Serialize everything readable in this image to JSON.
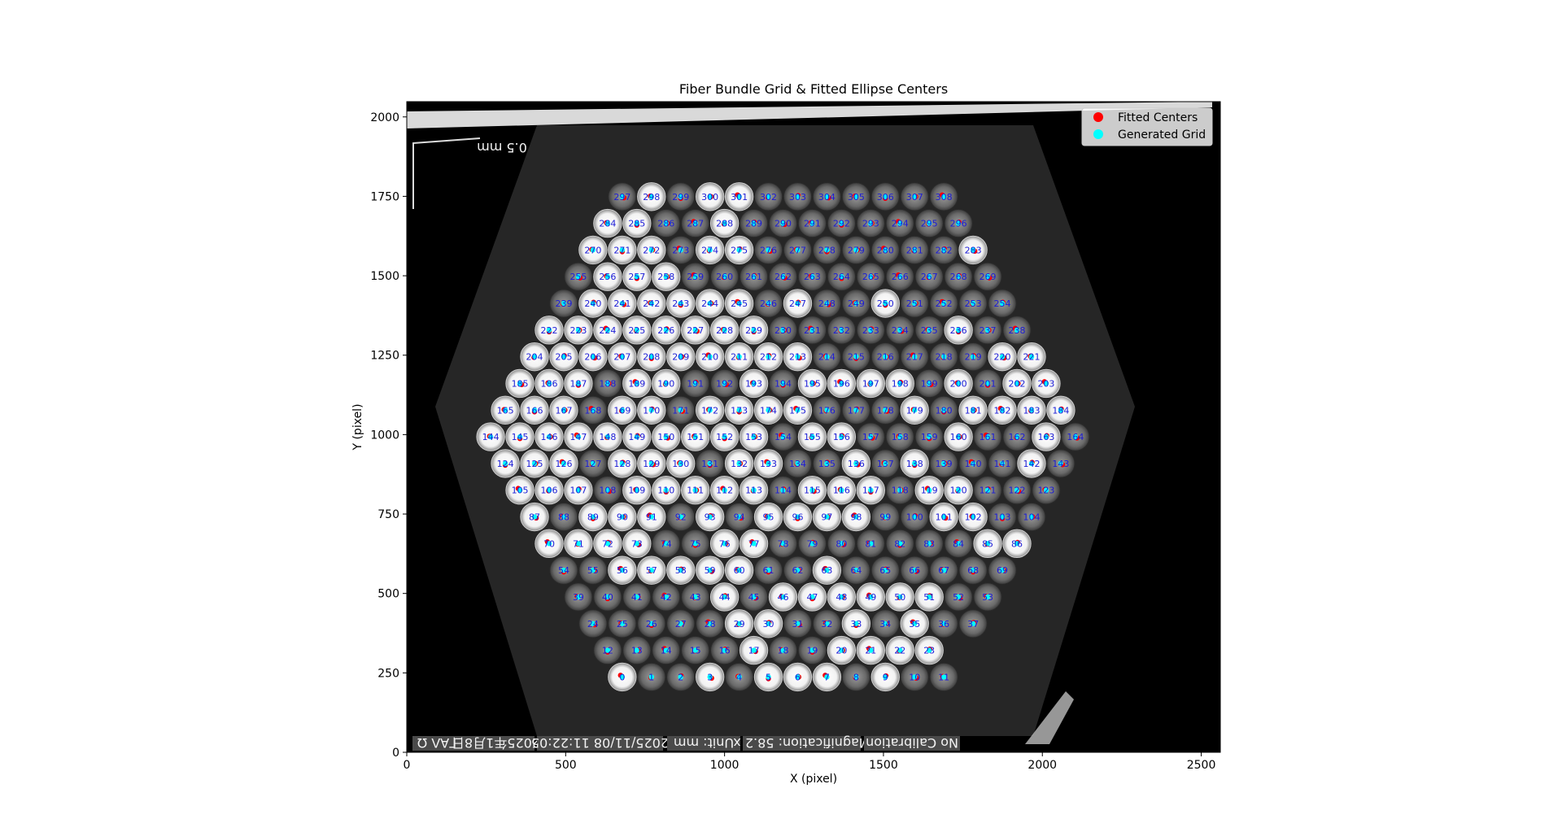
{
  "chart_data": {
    "type": "scatter",
    "title": "Fiber Bundle Grid & Fitted Ellipse Centers",
    "xlabel": "X (pixel)",
    "ylabel": "Y (pixel)",
    "xlim": [
      0,
      2560
    ],
    "ylim": [
      0,
      2048
    ],
    "xticks": [
      0,
      500,
      1000,
      1500,
      2000,
      2500
    ],
    "yticks": [
      0,
      250,
      500,
      750,
      1000,
      1250,
      1500,
      1750,
      2000
    ],
    "legend_position": "top-right",
    "series": [
      {
        "name": "Fitted Centers",
        "color": "#ff0000",
        "marker": "circle"
      },
      {
        "name": "Generated Grid",
        "color": "#00ffff",
        "marker": "circle"
      }
    ],
    "grid": {
      "rows": [
        {
          "y": 237,
          "x_start": 678,
          "count": 12,
          "first_index": 0
        },
        {
          "y": 321,
          "x_start": 632,
          "count": 12,
          "first_index": 12
        },
        {
          "y": 405,
          "x_start": 586,
          "count": 14,
          "first_index": 24
        },
        {
          "y": 489,
          "x_start": 540,
          "count": 15,
          "first_index": 39
        },
        {
          "y": 573,
          "x_start": 494,
          "count": 16,
          "first_index": 54
        },
        {
          "y": 657,
          "x_start": 448,
          "count": 17,
          "first_index": 70
        },
        {
          "y": 741,
          "x_start": 402,
          "count": 18,
          "first_index": 87
        },
        {
          "y": 825,
          "x_start": 356,
          "count": 19,
          "first_index": 105
        },
        {
          "y": 909,
          "x_start": 310,
          "count": 20,
          "first_index": 124
        },
        {
          "y": 993,
          "x_start": 264,
          "count": 21,
          "first_index": 144
        },
        {
          "y": 1077,
          "x_start": 310,
          "count": 20,
          "first_index": 165
        },
        {
          "y": 1161,
          "x_start": 356,
          "count": 19,
          "first_index": 185
        },
        {
          "y": 1245,
          "x_start": 402,
          "count": 18,
          "first_index": 204
        },
        {
          "y": 1329,
          "x_start": 448,
          "count": 17,
          "first_index": 222
        },
        {
          "y": 1413,
          "x_start": 494,
          "count": 16,
          "first_index": 239
        },
        {
          "y": 1497,
          "x_start": 540,
          "count": 15,
          "first_index": 255
        },
        {
          "y": 1581,
          "x_start": 586,
          "count": 14,
          "first_index": 270
        },
        {
          "y": 1665,
          "x_start": 632,
          "count": 13,
          "first_index": 284
        },
        {
          "y": 1749,
          "x_start": 678,
          "count": 12,
          "first_index": 297
        }
      ],
      "spacing_x": 92
    },
    "bright_fibers": [
      0,
      3,
      5,
      6,
      7,
      9,
      17,
      20,
      21,
      22,
      23,
      29,
      30,
      33,
      35,
      38,
      44,
      46,
      47,
      48,
      49,
      50,
      51,
      56,
      57,
      58,
      59,
      60,
      63,
      70,
      71,
      72,
      73,
      76,
      77,
      85,
      86,
      87,
      89,
      90,
      91,
      93,
      95,
      96,
      97,
      98,
      101,
      102,
      105,
      106,
      107,
      109,
      110,
      111,
      112,
      113,
      115,
      116,
      117,
      119,
      120,
      124,
      125,
      126,
      128,
      129,
      130,
      132,
      133,
      136,
      138,
      142,
      144,
      145,
      146,
      147,
      148,
      149,
      150,
      151,
      152,
      153,
      155,
      156,
      160,
      163,
      165,
      166,
      167,
      169,
      170,
      172,
      173,
      174,
      175,
      179,
      181,
      182,
      183,
      184,
      185,
      186,
      187,
      189,
      190,
      193,
      195,
      196,
      197,
      198,
      200,
      202,
      203,
      204,
      205,
      206,
      207,
      208,
      209,
      210,
      211,
      212,
      213,
      220,
      221,
      222,
      223,
      224,
      225,
      226,
      227,
      228,
      229,
      236,
      240,
      241,
      242,
      243,
      244,
      245,
      247,
      250,
      256,
      257,
      258,
      270,
      271,
      272,
      274,
      275,
      283,
      284,
      285,
      288,
      298,
      300,
      301
    ]
  },
  "overlay": {
    "scale_bar_label": "0.5 mm",
    "status_bar": [
      "ΓΑΛ Ω",
      "2025年1月8日",
      "2025/11/08 11:22:05",
      "Unit: mm",
      "Magnification: 58.2 x",
      "No Calibration"
    ]
  }
}
